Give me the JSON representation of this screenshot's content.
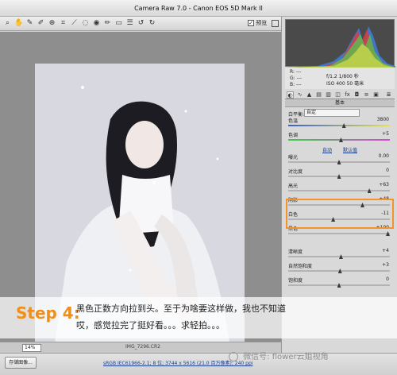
{
  "window": {
    "title": "Camera Raw 7.0 -  Canon EOS 5D Mark II"
  },
  "toolbar": {
    "tools": [
      "zoom-icon",
      "hand-icon",
      "white-balance-icon",
      "color-sampler-icon",
      "target-adjust-icon",
      "crop-icon",
      "straighten-icon",
      "spot-removal-icon",
      "red-eye-icon",
      "adjustment-brush-icon",
      "graduated-filter-icon",
      "list-icon",
      "rotate-left-icon",
      "rotate-right-icon"
    ],
    "preview_label": "预览",
    "preview_checked": "✓"
  },
  "camera_info": {
    "r": "R: ---",
    "g": "G: ---",
    "b": "B: ---",
    "aperture_shutter": "f/1.2   1/800 秒",
    "iso_focal": "ISO 400   50 毫米"
  },
  "panel": {
    "title": "基本",
    "white_balance_label": "白平衡:",
    "white_balance_value": "自定",
    "auto_label": "自动",
    "default_label": "默认值"
  },
  "sliders_top": [
    {
      "label": "色温",
      "value": "3800",
      "pos": 0.55
    },
    {
      "label": "色调",
      "value": "+5",
      "pos": 0.52
    }
  ],
  "sliders_tone": [
    {
      "label": "曝光",
      "value": "0.00",
      "pos": 0.5
    },
    {
      "label": "对比度",
      "value": "0",
      "pos": 0.5
    },
    {
      "label": "高光",
      "value": "+63",
      "pos": 0.81
    },
    {
      "label": "阴影",
      "value": "+48",
      "pos": 0.74
    },
    {
      "label": "白色",
      "value": "-11",
      "pos": 0.44
    },
    {
      "label": "黑色",
      "value": "+100",
      "pos": 1.0
    }
  ],
  "sliders_presence": [
    {
      "label": "清晰度",
      "value": "+4",
      "pos": 0.52
    },
    {
      "label": "自然饱和度",
      "value": "+3",
      "pos": 0.51
    },
    {
      "label": "饱和度",
      "value": "0",
      "pos": 0.5
    }
  ],
  "statusbar": {
    "zoom": "14%",
    "filename": "IMG_7296.CR2"
  },
  "bottombar": {
    "save_label": "存储图像...",
    "workflow_link": "sRGB IEC61966-2.1; 8 位; 3744 x 5616 (21.0 百万像素); 240 ppi"
  },
  "caption": {
    "step": "Step 4:",
    "line1": "黑色正数方向拉到头。至于为啥要这样做，我也不知道",
    "line2": "哎，感觉拉完了挺好看。。。求轻拍。。。"
  },
  "watermark": {
    "text": "微信号: flower云姐视角"
  },
  "colors": {
    "highlight": "#f2942a",
    "step": "#ef8f1a"
  }
}
